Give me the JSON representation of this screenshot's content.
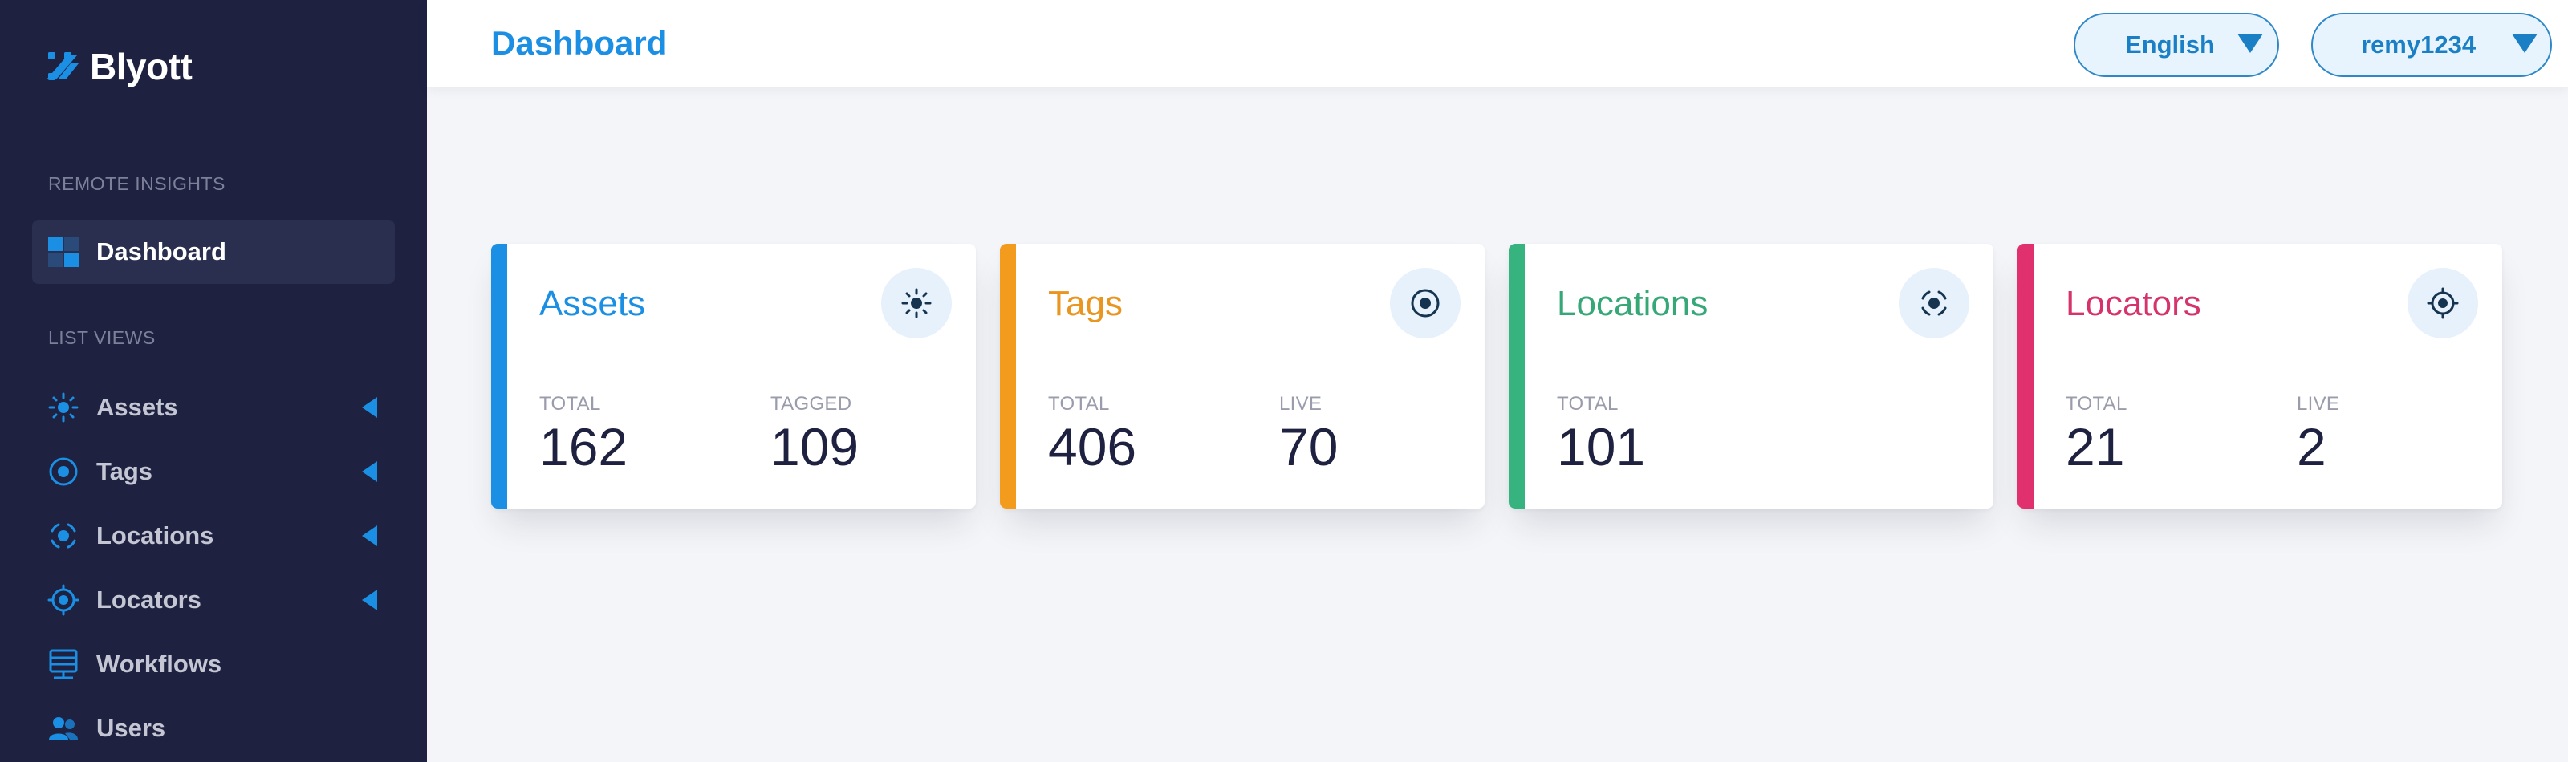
{
  "brand": {
    "name": "Blyott"
  },
  "sidebar": {
    "sections": [
      {
        "label": "REMOTE INSIGHTS"
      },
      {
        "label": "LIST VIEWS"
      }
    ],
    "items": [
      {
        "label": "Dashboard",
        "icon": "dashboard-icon",
        "active": true
      },
      {
        "label": "Assets",
        "icon": "sun-icon",
        "expandable": true
      },
      {
        "label": "Tags",
        "icon": "tag-target-icon",
        "expandable": true
      },
      {
        "label": "Locations",
        "icon": "location-focus-icon",
        "expandable": true
      },
      {
        "label": "Locators",
        "icon": "locator-icon",
        "expandable": true
      },
      {
        "label": "Workflows",
        "icon": "workflow-icon"
      },
      {
        "label": "Users",
        "icon": "users-icon"
      }
    ]
  },
  "header": {
    "title": "Dashboard",
    "language": "English",
    "user": "remy1234"
  },
  "cards": [
    {
      "title": "Assets",
      "color": "#1a8fe3",
      "icon": "sun-icon",
      "stats": [
        {
          "label": "TOTAL",
          "value": "162"
        },
        {
          "label": "TAGGED",
          "value": "109"
        }
      ]
    },
    {
      "title": "Tags",
      "color": "#f29b1d",
      "icon": "tag-target-icon",
      "stats": [
        {
          "label": "TOTAL",
          "value": "406"
        },
        {
          "label": "LIVE",
          "value": "70"
        }
      ]
    },
    {
      "title": "Locations",
      "color": "#36b37e",
      "icon": "location-focus-icon",
      "stats": [
        {
          "label": "TOTAL",
          "value": "101"
        }
      ]
    },
    {
      "title": "Locators",
      "color": "#e0306d",
      "icon": "locator-icon",
      "stats": [
        {
          "label": "TOTAL",
          "value": "21"
        },
        {
          "label": "LIVE",
          "value": "2"
        }
      ]
    }
  ],
  "colors": {
    "sidebar_bg": "#1e2140",
    "accent": "#1a8fe3",
    "icon_dark": "#16344f"
  }
}
